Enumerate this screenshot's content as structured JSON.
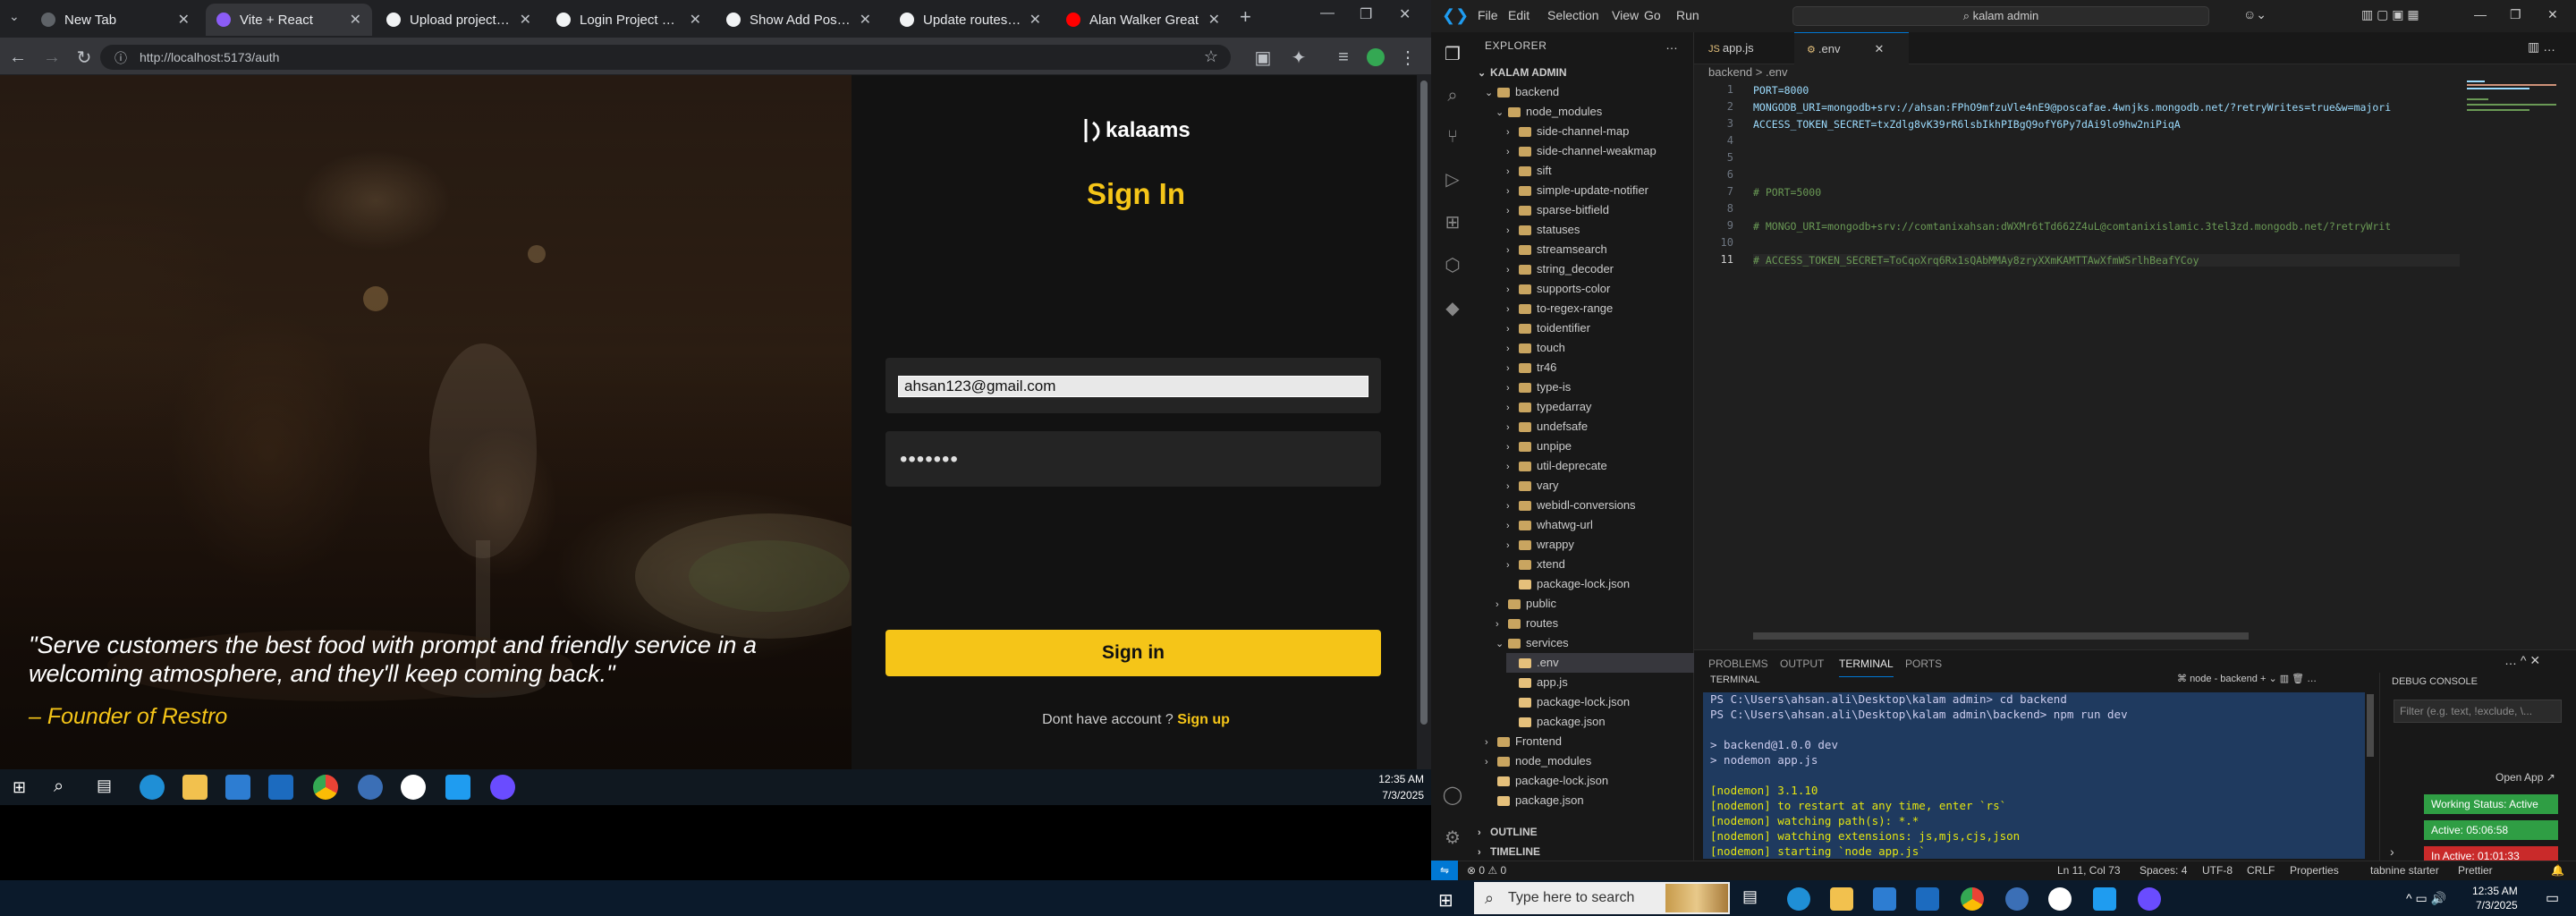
{
  "browser": {
    "tabs": [
      {
        "title": "New Tab",
        "icon": "chrome-icon",
        "color": "#5f6368"
      },
      {
        "title": "Vite + React",
        "icon": "vite-icon",
        "color": "#8b5cf6"
      },
      {
        "title": "Upload project to kala",
        "icon": "chatgpt-icon",
        "color": "#f1f3f4"
      },
      {
        "title": "Login Project Code He",
        "icon": "chatgpt-icon",
        "color": "#f1f3f4"
      },
      {
        "title": "Show Add Post Button",
        "icon": "chatgpt-icon",
        "color": "#f1f3f4"
      },
      {
        "title": "Update routes in app.j",
        "icon": "chatgpt-icon",
        "color": "#f1f3f4"
      },
      {
        "title": "Alan Walker Great",
        "icon": "youtube-icon",
        "color": "#ff0000"
      }
    ],
    "url": "http://localhost:5173/auth",
    "page": {
      "logo": "kalaams",
      "heading": "Sign In",
      "email_value": "ahsan123@gmail.com",
      "password_mask": "•••••••",
      "signin_label": "Sign in",
      "no_account": "Dont have account ?",
      "signup_label": "Sign up",
      "quote": "\"Serve customers the best food with prompt and friendly service in a welcoming atmosphere, and they'll keep coming back.\"",
      "author": "– Founder of Restro",
      "accent": "#f5c518"
    },
    "taskbar_clock": {
      "time": "12:35 AM",
      "date": "7/3/2025"
    }
  },
  "vscode": {
    "menu": [
      "File",
      "Edit",
      "Selection",
      "View",
      "Go",
      "Run"
    ],
    "search": "kalam admin",
    "explorer_title": "EXPLORER",
    "workspace": "KALAM ADMIN",
    "tree": [
      {
        "label": "backend",
        "depth": 0,
        "type": "folder-open"
      },
      {
        "label": "node_modules",
        "depth": 1,
        "type": "folder-open"
      },
      {
        "label": "side-channel-map",
        "depth": 2,
        "type": "folder"
      },
      {
        "label": "side-channel-weakmap",
        "depth": 2,
        "type": "folder"
      },
      {
        "label": "sift",
        "depth": 2,
        "type": "folder"
      },
      {
        "label": "simple-update-notifier",
        "depth": 2,
        "type": "folder"
      },
      {
        "label": "sparse-bitfield",
        "depth": 2,
        "type": "folder"
      },
      {
        "label": "statuses",
        "depth": 2,
        "type": "folder"
      },
      {
        "label": "streamsearch",
        "depth": 2,
        "type": "folder"
      },
      {
        "label": "string_decoder",
        "depth": 2,
        "type": "folder"
      },
      {
        "label": "supports-color",
        "depth": 2,
        "type": "folder"
      },
      {
        "label": "to-regex-range",
        "depth": 2,
        "type": "folder"
      },
      {
        "label": "toidentifier",
        "depth": 2,
        "type": "folder"
      },
      {
        "label": "touch",
        "depth": 2,
        "type": "folder"
      },
      {
        "label": "tr46",
        "depth": 2,
        "type": "folder"
      },
      {
        "label": "type-is",
        "depth": 2,
        "type": "folder"
      },
      {
        "label": "typedarray",
        "depth": 2,
        "type": "folder"
      },
      {
        "label": "undefsafe",
        "depth": 2,
        "type": "folder"
      },
      {
        "label": "unpipe",
        "depth": 2,
        "type": "folder"
      },
      {
        "label": "util-deprecate",
        "depth": 2,
        "type": "folder"
      },
      {
        "label": "vary",
        "depth": 2,
        "type": "folder"
      },
      {
        "label": "webidl-conversions",
        "depth": 2,
        "type": "folder"
      },
      {
        "label": "whatwg-url",
        "depth": 2,
        "type": "folder"
      },
      {
        "label": "wrappy",
        "depth": 2,
        "type": "folder"
      },
      {
        "label": "xtend",
        "depth": 2,
        "type": "folder"
      },
      {
        "label": "package-lock.json",
        "depth": 2,
        "type": "json"
      },
      {
        "label": "public",
        "depth": 1,
        "type": "folder"
      },
      {
        "label": "routes",
        "depth": 1,
        "type": "folder"
      },
      {
        "label": "services",
        "depth": 1,
        "type": "folder-open"
      },
      {
        "label": ".env",
        "depth": 2,
        "type": "env"
      },
      {
        "label": "app.js",
        "depth": 2,
        "type": "js"
      },
      {
        "label": "package-lock.json",
        "depth": 2,
        "type": "json"
      },
      {
        "label": "package.json",
        "depth": 2,
        "type": "json"
      },
      {
        "label": "Frontend",
        "depth": 0,
        "type": "folder"
      },
      {
        "label": "node_modules",
        "depth": 0,
        "type": "folder"
      },
      {
        "label": "package-lock.json",
        "depth": 0,
        "type": "json"
      },
      {
        "label": "package.json",
        "depth": 0,
        "type": "json"
      }
    ],
    "outline": "OUTLINE",
    "timeline": "TIMELINE",
    "editor_tabs": [
      "app.js",
      ".env"
    ],
    "breadcrumb": "backend > .env",
    "code": [
      "PORT=8000",
      "MONGODB_URI=mongodb+srv://ahsan:FPhO9mfzuVle4nE9@poscafae.4wnjks.mongodb.net/?retryWrites=true&w=majori",
      "ACCESS_TOKEN_SECRET=txZdlg8vK39rR6lsbIkhPIBgQ9ofY6Py7dAi9lo9hw2niPiqA",
      "",
      "",
      "",
      "# PORT=5000",
      "",
      "# MONGO_URI=mongodb+srv://comtanixahsan:dWXMr6tTd662Z4uL@comtanixislamic.3tel3zd.mongodb.net/?retryWrit",
      "",
      "# ACCESS_TOKEN_SECRET=ToCqoXrq6Rx1sQAbMMAy8zryXXmKAMTTAwXfmWSrlhBeafYCoy"
    ],
    "panel_tabs": [
      "PROBLEMS",
      "OUTPUT",
      "TERMINAL",
      "PORTS"
    ],
    "terminal_title": "TERMINAL",
    "terminal_name": "node - backend",
    "terminal": [
      "PS C:\\Users\\ahsan.ali\\Desktop\\kalam admin> cd backend",
      "PS C:\\Users\\ahsan.ali\\Desktop\\kalam admin\\backend> npm run dev",
      "",
      "> backend@1.0.0 dev",
      "> nodemon app.js",
      "",
      "[nodemon] 3.1.10",
      "[nodemon] to restart at any time, enter `rs`",
      "[nodemon] watching path(s): *.*",
      "[nodemon] watching extensions: js,mjs,cjs,json",
      "[nodemon] starting `node app.js`"
    ],
    "debug_title": "DEBUG CONSOLE",
    "debug_filter": "Filter (e.g. text, !exclude, \\...",
    "open_app": "Open App ↗",
    "working_status": "Working Status: Active",
    "active_time": "Active: 05:06:58",
    "inactive_time": "In Active: 01:01:33",
    "status": {
      "errors": "⊗ 0 ⚠ 0",
      "position": "Ln 11, Col 73",
      "spaces": "Spaces: 4",
      "encoding": "UTF-8",
      "eol": "CRLF",
      "properties": "Properties",
      "tabnine": "tabnine starter",
      "prettier": "Prettier"
    }
  },
  "windows": {
    "search_placeholder": "Type here to search",
    "time": "12:35 AM",
    "date": "7/3/2025"
  }
}
